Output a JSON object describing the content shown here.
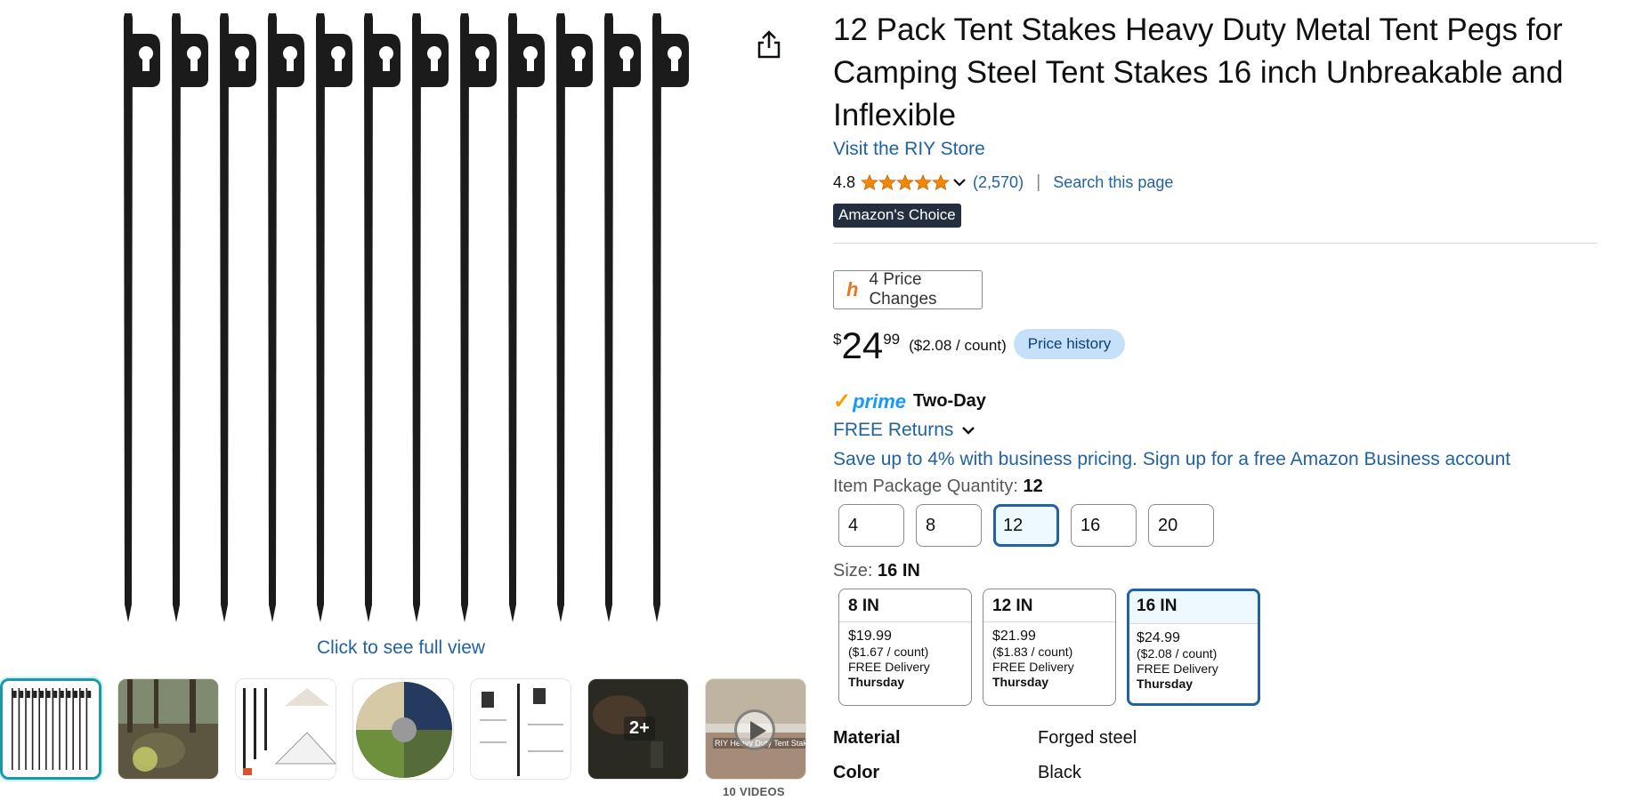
{
  "product": {
    "title": "12 Pack Tent Stakes Heavy Duty Metal Tent Pegs for Camping Steel Tent Stakes 16 inch Unbreakable and Inflexible",
    "store_link": "Visit the RIY Store",
    "rating": "4.8",
    "rating_value": 4.8,
    "review_count": "(2,570)",
    "separator": "|",
    "search_page": "Search this page",
    "badge": "Amazon's Choice"
  },
  "pricing": {
    "price_changes": "4 Price Changes",
    "currency": "$",
    "whole": "24",
    "fraction": "99",
    "unit_price": "($2.08 / count)",
    "price_history": "Price history"
  },
  "delivery": {
    "prime": "prime",
    "prime_speed": "Two-Day",
    "free_returns": "FREE Returns",
    "business": "Save up to 4% with business pricing. Sign up for a free Amazon Business account"
  },
  "quantity": {
    "label": "Item Package Quantity:",
    "selected": "12",
    "options": [
      "4",
      "8",
      "12",
      "16",
      "20"
    ]
  },
  "size": {
    "label": "Size:",
    "selected": "16 IN",
    "options": [
      {
        "name": "8 IN",
        "price": "$19.99",
        "unit": "($1.67 / count)",
        "delivery": "FREE Delivery",
        "day": "Thursday"
      },
      {
        "name": "12 IN",
        "price": "$21.99",
        "unit": "($1.83 / count)",
        "delivery": "FREE Delivery",
        "day": "Thursday"
      },
      {
        "name": "16 IN",
        "price": "$24.99",
        "unit": "($2.08 / count)",
        "delivery": "FREE Delivery",
        "day": "Thursday"
      }
    ]
  },
  "specs": [
    {
      "key": "Material",
      "value": "Forged steel"
    },
    {
      "key": "Color",
      "value": "Black"
    }
  ],
  "gallery": {
    "full_view": "Click to see full view",
    "more_count": "2+",
    "videos_label": "10 VIDEOS",
    "video_caption": "RIY Heavy Duty Tent Stakes"
  }
}
